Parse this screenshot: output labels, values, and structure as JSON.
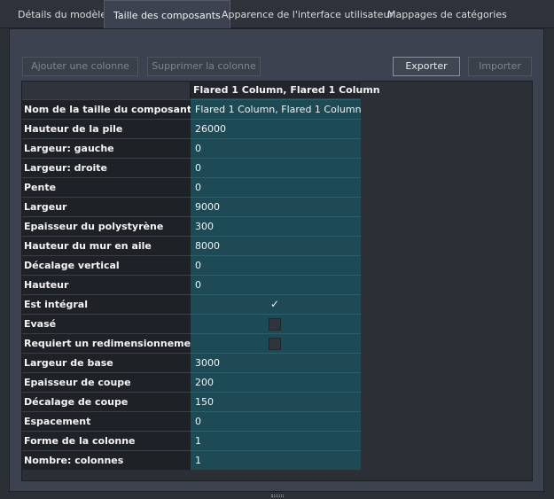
{
  "tabs": [
    {
      "label": "Détails du modèle",
      "active": false
    },
    {
      "label": "Taille des composants",
      "active": true
    },
    {
      "label": "Apparence de l'interface utilisateur",
      "active": false
    },
    {
      "label": "Mappages de catégories",
      "active": false
    }
  ],
  "toolbar": {
    "add_column": "Ajouter une colonne",
    "remove_column": "Supprimer la colonne",
    "export": "Exporter",
    "import": "Importer"
  },
  "grid": {
    "column_header": "Flared 1 Column, Flared 1 Column",
    "rows": [
      {
        "label": "Nom de la taille du composant",
        "value": "Flared 1 Column, Flared 1 Column"
      },
      {
        "label": "Hauteur de la pile",
        "value": "26000"
      },
      {
        "label": "Largeur: gauche",
        "value": "0"
      },
      {
        "label": "Largeur: droite",
        "value": "0"
      },
      {
        "label": "Pente",
        "value": "0"
      },
      {
        "label": "Largeur",
        "value": "9000"
      },
      {
        "label": "Epaisseur du polystyrène",
        "value": "300"
      },
      {
        "label": "Hauteur du mur en aile",
        "value": "8000"
      },
      {
        "label": "Décalage vertical",
        "value": "0"
      },
      {
        "label": "Hauteur",
        "value": "0"
      },
      {
        "label": "Est intégral",
        "checkbox": true,
        "checked": true
      },
      {
        "label": "Evasé",
        "checkbox": true,
        "checked": false
      },
      {
        "label": "Requiert un redimensionnement",
        "checkbox": true,
        "checked": false
      },
      {
        "label": "Largeur de base",
        "value": "3000"
      },
      {
        "label": "Epaisseur de coupe",
        "value": "200"
      },
      {
        "label": "Décalage de coupe",
        "value": "150"
      },
      {
        "label": "Espacement",
        "value": "0"
      },
      {
        "label": "Forme de la colonne",
        "value": "1"
      },
      {
        "label": "Nombre: colonnes",
        "value": "1"
      }
    ]
  },
  "colors": {
    "value_cell": "#1d4a55",
    "label_cell": "#1e2126",
    "panel": "#3c4250"
  }
}
